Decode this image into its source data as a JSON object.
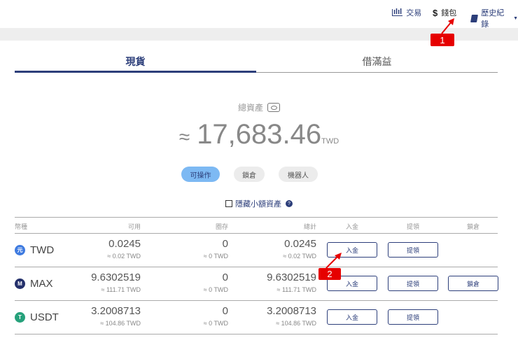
{
  "nav": {
    "trade": "交易",
    "wallet": "錢包",
    "history": "歷史紀錄"
  },
  "tabs": [
    {
      "label": "現貨",
      "active": true
    },
    {
      "label": "借滿益",
      "active": false
    }
  ],
  "summary": {
    "label": "總資產",
    "approx": "≈",
    "amount": "17,683.46",
    "currency": "TWD"
  },
  "filters": [
    {
      "label": "可操作",
      "active": true
    },
    {
      "label": "鎖倉",
      "active": false
    },
    {
      "label": "機器人",
      "active": false
    }
  ],
  "hide_small": {
    "label": "隱藏小額資產",
    "checked": false
  },
  "table": {
    "headers": {
      "coin": "幣種",
      "available": "可用",
      "locked": "圈存",
      "total": "總計",
      "deposit": "入金",
      "withdraw": "提領",
      "lock": "鎖倉"
    },
    "rows": [
      {
        "coin": "TWD",
        "icon_text": "元",
        "color": "#3f7be0",
        "available": "0.0245",
        "available_twd": "≈ 0.02 TWD",
        "locked": "0",
        "locked_twd": "≈ 0 TWD",
        "total": "0.0245",
        "total_twd": "≈ 0.02 TWD",
        "deposit": "入金",
        "withdraw": "提領"
      },
      {
        "coin": "MAX",
        "icon_text": "M",
        "color": "#24306b",
        "available": "9.6302519",
        "available_twd": "≈ 111.71 TWD",
        "locked": "0",
        "locked_twd": "≈ 0 TWD",
        "total": "9.6302519",
        "total_twd": "≈ 111.71 TWD",
        "deposit": "入金",
        "withdraw": "提領",
        "lock": "鎖倉"
      },
      {
        "coin": "USDT",
        "icon_text": "T",
        "color": "#26a17b",
        "available": "3.2008713",
        "available_twd": "≈ 104.86 TWD",
        "locked": "0",
        "locked_twd": "≈ 0 TWD",
        "total": "3.2008713",
        "total_twd": "≈ 104.86 TWD",
        "deposit": "入金",
        "withdraw": "提領"
      }
    ]
  },
  "annotations": [
    "1",
    "2"
  ],
  "colors": {
    "primary": "#2c3e7a",
    "pill_active": "#7db9f3",
    "annotation": "#e60000"
  }
}
